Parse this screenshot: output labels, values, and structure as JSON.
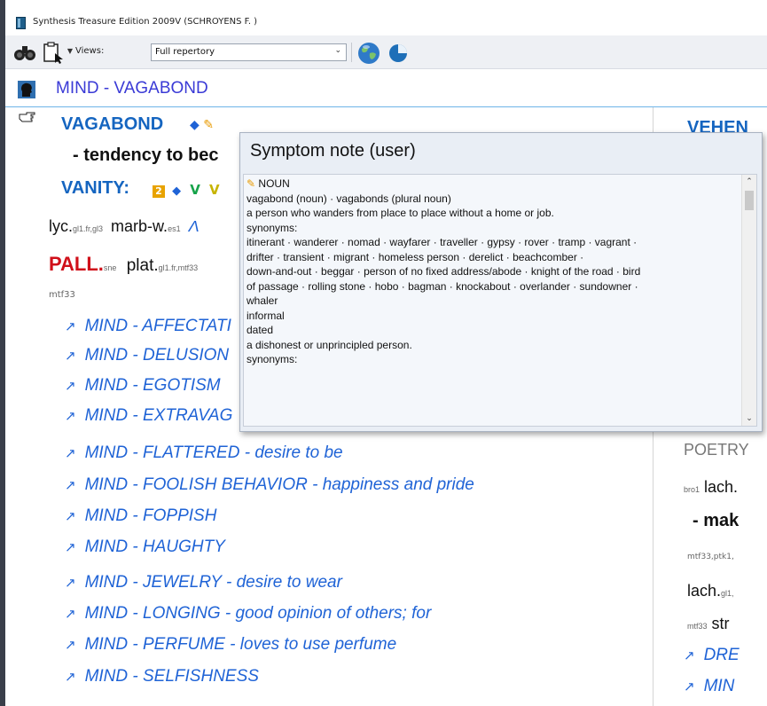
{
  "window": {
    "title": "Synthesis Treasure Edition 2009V (SCHROYENS F. )"
  },
  "toolbar": {
    "views_label": "Views:",
    "views_value": "Full repertory",
    "dropdown_caret": "▼"
  },
  "heading": {
    "text": "MIND - VAGABOND"
  },
  "rubrics": {
    "vagabond": "VAGABOND",
    "tendency": "- tendency to bec",
    "vanity": "VANITY:",
    "vanity_badge": "2",
    "vanity_v1": "V",
    "vanity_v2": "V"
  },
  "remedies": {
    "line1": [
      {
        "name": "lyc.",
        "sub": "gl1.fr,gl3"
      },
      {
        "name": "marb-w.",
        "sub": "es1"
      },
      {
        "name": "Λ",
        "sub": ""
      }
    ],
    "line2": [
      {
        "name": "PALL.",
        "sub": "sne"
      },
      {
        "name": "plat.",
        "sub": "gl1.fr,mtf33"
      }
    ],
    "source": "mtf33"
  },
  "crossrefs": [
    {
      "main": "MIND - AFFECTATI",
      "detail": ""
    },
    {
      "main": "MIND - DELUSION",
      "detail": ""
    },
    {
      "main": "MIND - EGOTISM",
      "detail": ""
    },
    {
      "main": "MIND - EXTRAVAG",
      "detail": ""
    },
    {
      "main": "MIND - FLATTERED",
      "detail": " - desire to be"
    },
    {
      "main": "MIND - FOOLISH BEHAVIOR",
      "detail": " - happiness and pride"
    },
    {
      "main": "MIND - FOPPISH",
      "detail": ""
    },
    {
      "main": "MIND - HAUGHTY",
      "detail": ""
    },
    {
      "main": "MIND - JEWELRY",
      "detail": " - desire to wear"
    },
    {
      "main": "MIND - LONGING",
      "detail": " - good opinion of others; for"
    },
    {
      "main": "MIND - PERFUME",
      "detail": " - loves to use perfume"
    },
    {
      "main": "MIND - SELFISHNESS",
      "detail": ""
    }
  ],
  "crossref_arrow": "↗",
  "right_column": {
    "vehen": "VEHEN",
    "poetry": "POETRY",
    "bro_sub": "bro1",
    "lach": "lach.",
    "mak": "- mak",
    "sources": "mtf33,ptk1,",
    "lach2": "lach.",
    "lach2_sub": "gl1,",
    "mtf_sub": "mtf33",
    "str": "str",
    "dre": "DRE",
    "min": "MIN"
  },
  "popup": {
    "title": "Symptom note (user)",
    "lines": [
      "NOUN",
      "vagabond (noun) · vagabonds (plural noun)",
      "a person who wanders from place to place without a home or job.",
      "synonyms:",
      "itinerant · wanderer · nomad · wayfarer · traveller · gypsy · rover · tramp · vagrant ·",
      "drifter · transient · migrant · homeless person · derelict · beachcomber ·",
      "down-and-out · beggar · person of no fixed address/abode · knight of the road · bird",
      "of passage · rolling stone · hobo · bagman · knockabout · overlander · sundowner ·",
      "whaler",
      "informal",
      "dated",
      "a dishonest or unprincipled person.",
      "synonyms:"
    ]
  },
  "colors": {
    "rubric_blue": "#1565c0",
    "heading_blue": "#3a3ad6",
    "crossref_blue": "#1f63d6",
    "remedy_red": "#d0101a",
    "popup_bg": "#e9eef5"
  }
}
